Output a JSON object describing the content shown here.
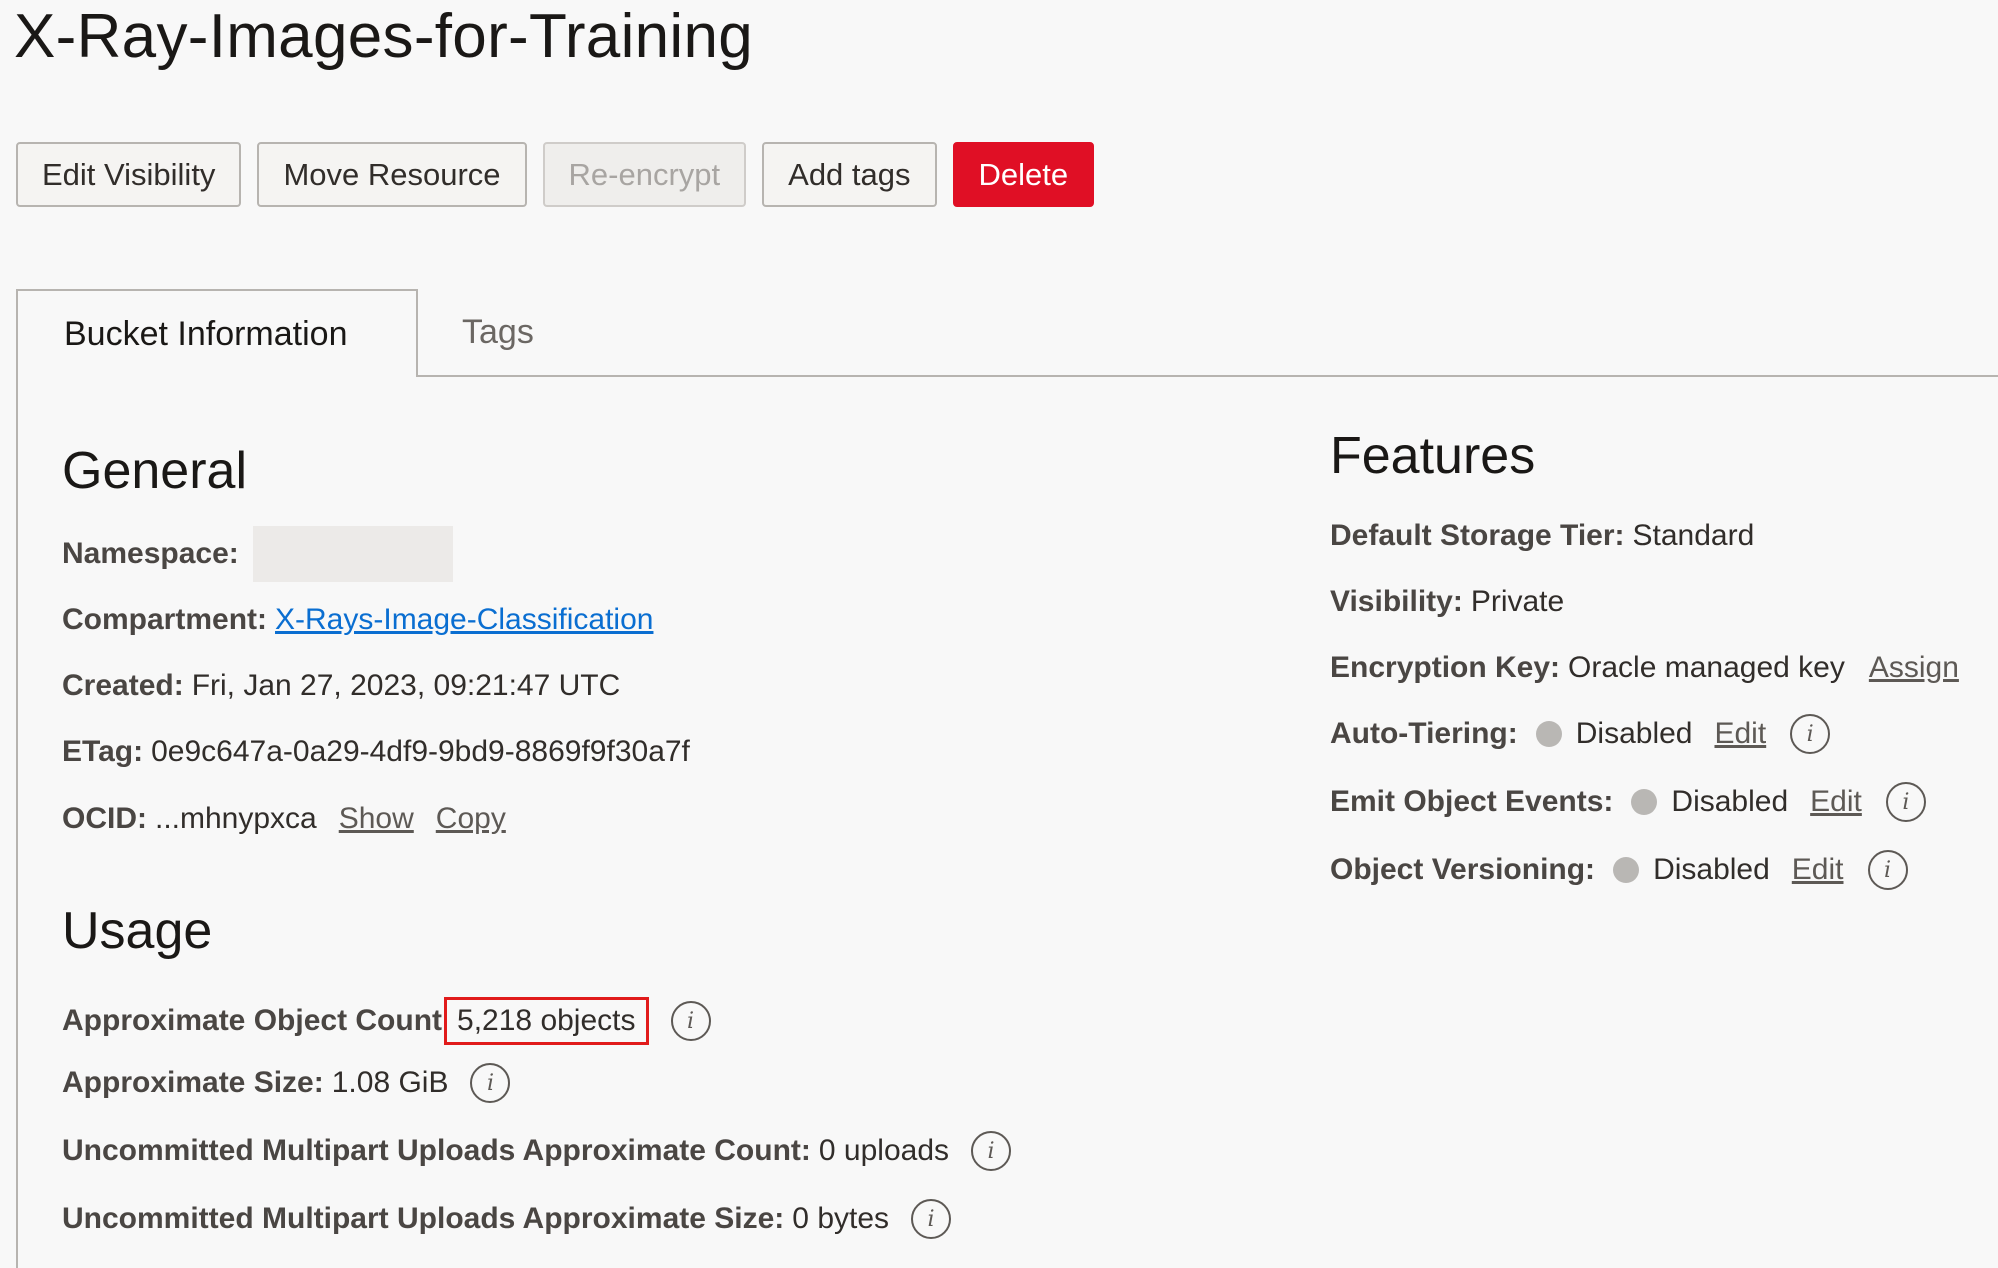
{
  "page": {
    "title": "X-Ray-Images-for-Training"
  },
  "toolbar": {
    "edit_visibility": "Edit Visibility",
    "move_resource": "Move Resource",
    "re_encrypt": "Re-encrypt",
    "add_tags": "Add tags",
    "delete": "Delete"
  },
  "tabs": {
    "bucket_information": "Bucket Information",
    "tags": "Tags"
  },
  "general": {
    "title": "General",
    "namespace_label": "Namespace:",
    "compartment_label": "Compartment:",
    "compartment_value": "X-Rays-Image-Classification",
    "created_label": "Created:",
    "created_value": "Fri, Jan 27, 2023, 09:21:47 UTC",
    "etag_label": "ETag:",
    "etag_value": "0e9c647a-0a29-4df9-9bd9-8869f9f30a7f",
    "ocid_label": "OCID:",
    "ocid_value": "...mhnypxca",
    "show_link": "Show",
    "copy_link": "Copy"
  },
  "usage": {
    "title": "Usage",
    "object_count_label": "Approximate Object Count",
    "object_count_value": "5,218 objects",
    "size_label": "Approximate Size:",
    "size_value": "1.08 GiB",
    "uncommitted_count_label": "Uncommitted Multipart Uploads Approximate Count:",
    "uncommitted_count_value": "0 uploads",
    "uncommitted_size_label": "Uncommitted Multipart Uploads Approximate Size:",
    "uncommitted_size_value": "0 bytes"
  },
  "features": {
    "title": "Features",
    "storage_tier_label": "Default Storage Tier:",
    "storage_tier_value": "Standard",
    "visibility_label": "Visibility:",
    "visibility_value": "Private",
    "encryption_label": "Encryption Key:",
    "encryption_value": "Oracle managed key",
    "assign_link": "Assign",
    "auto_tiering_label": "Auto-Tiering:",
    "auto_tiering_value": "Disabled",
    "emit_events_label": "Emit Object Events:",
    "emit_events_value": "Disabled",
    "versioning_label": "Object Versioning:",
    "versioning_value": "Disabled",
    "edit_link": "Edit",
    "info_glyph": "i"
  },
  "colors": {
    "danger": "#e00f25",
    "link": "#0a6ed1",
    "highlight": "#e11b1b",
    "status_dot": "#b9b7b4"
  }
}
